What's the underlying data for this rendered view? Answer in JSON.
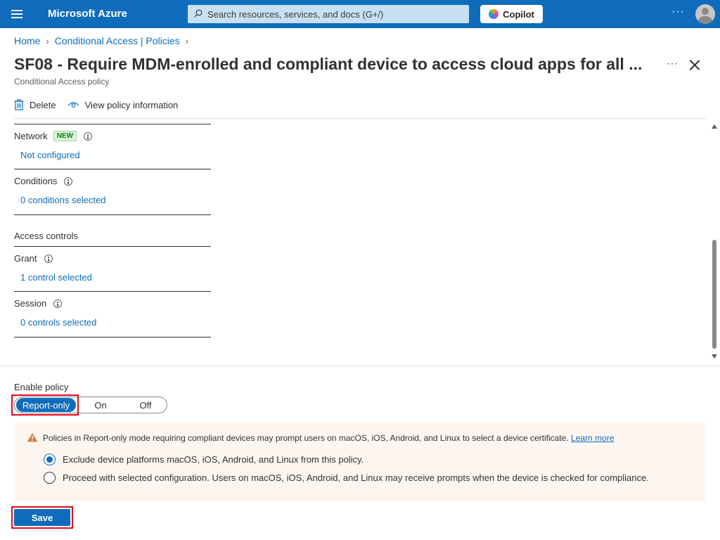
{
  "colors": {
    "accent": "#0f6cbd",
    "highlight_border": "#e00b1c",
    "warning_bg": "#fdf6f0",
    "warning_icon": "#d67f3c"
  },
  "topbar": {
    "brand": "Microsoft Azure",
    "search_placeholder": "Search resources, services, and docs (G+/)",
    "copilot_label": "Copilot",
    "more_label": "···"
  },
  "breadcrumb": {
    "items": [
      "Home",
      "Conditional Access | Policies"
    ]
  },
  "page": {
    "title": "SF08 - Require MDM-enrolled and compliant device to access cloud apps for all ...",
    "subtitle": "Conditional Access policy",
    "more_label": "···"
  },
  "commands": {
    "delete_label": "Delete",
    "view_info_label": "View policy information"
  },
  "assignments": {
    "network": {
      "label": "Network",
      "badge": "NEW",
      "value": "Not configured"
    },
    "conditions": {
      "label": "Conditions",
      "value": "0 conditions selected"
    }
  },
  "access_controls": {
    "heading": "Access controls",
    "grant": {
      "label": "Grant",
      "value": "1 control selected"
    },
    "session": {
      "label": "Session",
      "value": "0 controls selected"
    }
  },
  "enable_policy": {
    "label": "Enable policy",
    "options": [
      "Report-only",
      "On",
      "Off"
    ],
    "selected": "Report-only"
  },
  "warning": {
    "icon": "warning-icon",
    "text": "Policies in Report-only mode requiring compliant devices may prompt users on macOS, iOS, Android, and Linux to select a device certificate.",
    "link_label": "Learn more",
    "options": [
      {
        "label": "Exclude device platforms macOS, iOS, Android, and Linux from this policy.",
        "checked": true
      },
      {
        "label": "Proceed with selected configuration. Users on macOS, iOS, Android, and Linux may receive prompts when the device is checked for compliance.",
        "checked": false
      }
    ]
  },
  "footer": {
    "save_label": "Save"
  }
}
